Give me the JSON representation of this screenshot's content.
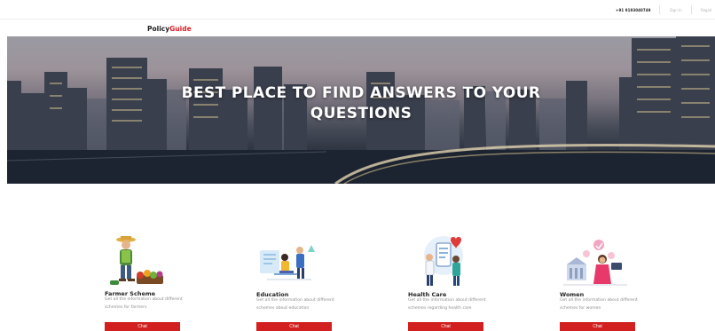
{
  "topbar": {
    "phone": "+91 9193040749",
    "sign_in": "Sign In",
    "register": "Regist"
  },
  "brand": {
    "part1": "Policy",
    "part2": "Guide",
    "accent_color": "#d92027"
  },
  "hero": {
    "headline_line1": "BEST PLACE TO FIND ANSWERS TO YOUR",
    "headline_line2": "QUESTIONS"
  },
  "cards": [
    {
      "title": "Farmer Scheme",
      "desc": "Get all the information about different schemes for farmers",
      "button": "Chat",
      "icon": "farmer-illustration"
    },
    {
      "title": "Education",
      "desc": "Get all the information about different schemes about education",
      "button": "Chat",
      "icon": "education-illustration"
    },
    {
      "title": "Health Care",
      "desc": "Get all the information about different schemes regarding health care",
      "button": "Chat",
      "icon": "health-care-illustration"
    },
    {
      "title": "Women",
      "desc": "Get all the information about different schemes for women",
      "button": "Chat",
      "icon": "women-illustration"
    }
  ],
  "colors": {
    "button": "#d21f1f",
    "title_text": "#222222",
    "desc_text": "#8c8c8c"
  }
}
